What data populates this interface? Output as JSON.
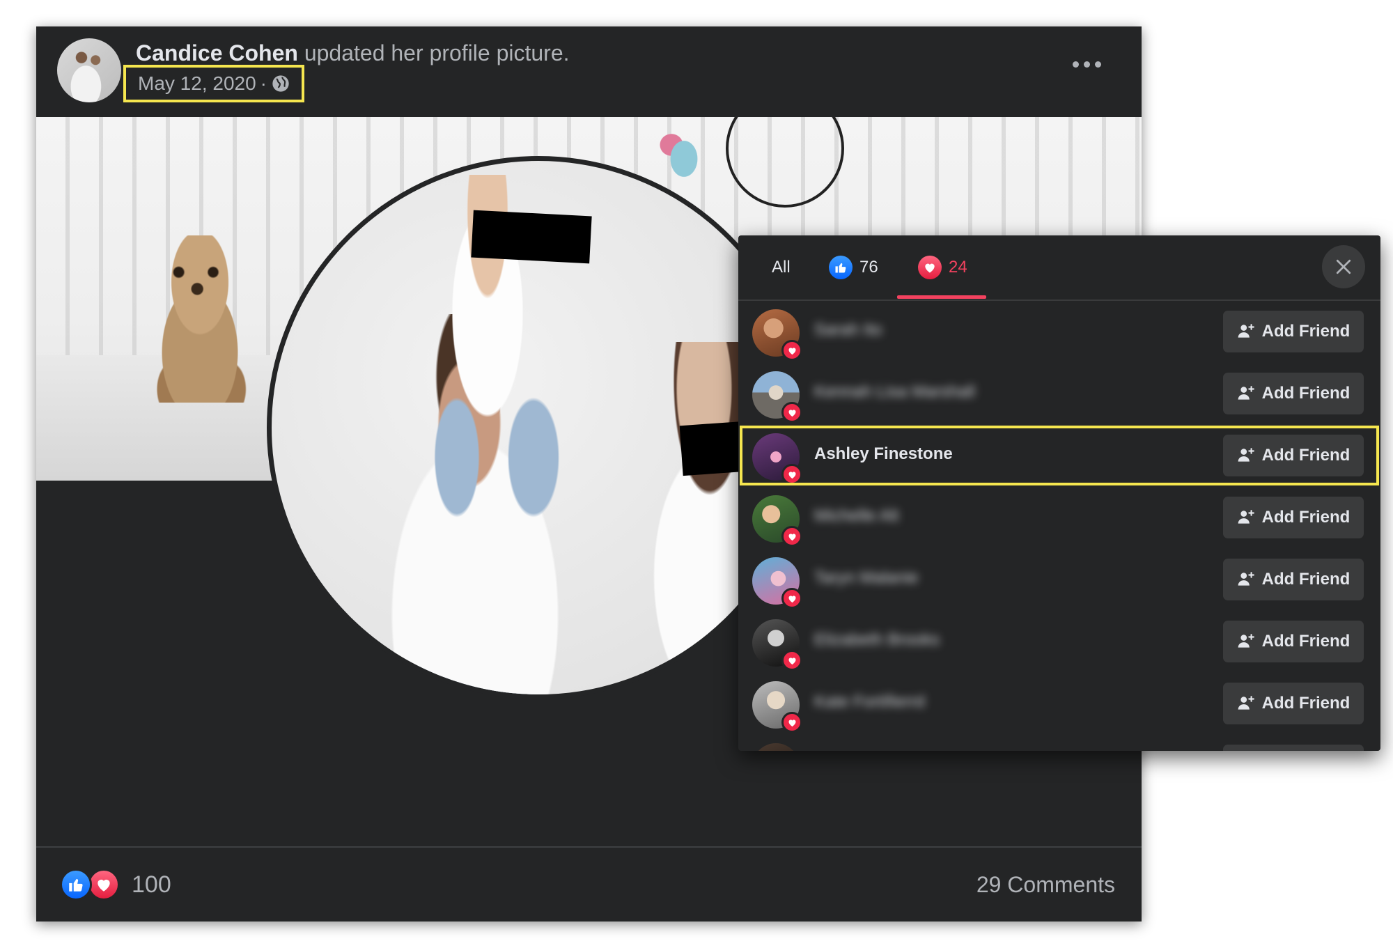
{
  "post": {
    "author": "Candice Cohen",
    "action": "updated her profile picture.",
    "date": "May 12, 2020",
    "separator": "·",
    "privacy_icon": "globe-icon",
    "menu_icon": "more-horizontal-icon"
  },
  "footer": {
    "reaction_count": "100",
    "comments": "29 Comments"
  },
  "reactions_panel": {
    "tabs": [
      {
        "label": "All"
      },
      {
        "icon": "like-icon",
        "count": "76"
      },
      {
        "icon": "love-icon",
        "count": "24"
      }
    ],
    "active_tab": 2,
    "close_icon": "close-icon",
    "add_friend_label": "Add Friend",
    "people": [
      {
        "name": "Sarah Ito"
      },
      {
        "name": "Kennah Lisa Marshall"
      },
      {
        "name": "Ashley Finestone"
      },
      {
        "name": "Michelle Alt"
      },
      {
        "name": "Taryn Malanie"
      },
      {
        "name": "Elizabeth Brooks"
      },
      {
        "name": "Kate Fortifierrd"
      }
    ],
    "highlighted_person": 2
  },
  "colors": {
    "background": "#242526",
    "highlight": "#f5e64f",
    "love": "#f3425f",
    "like": "#0866ff",
    "text": "#e4e6eb",
    "muted": "#b0b3b8"
  }
}
